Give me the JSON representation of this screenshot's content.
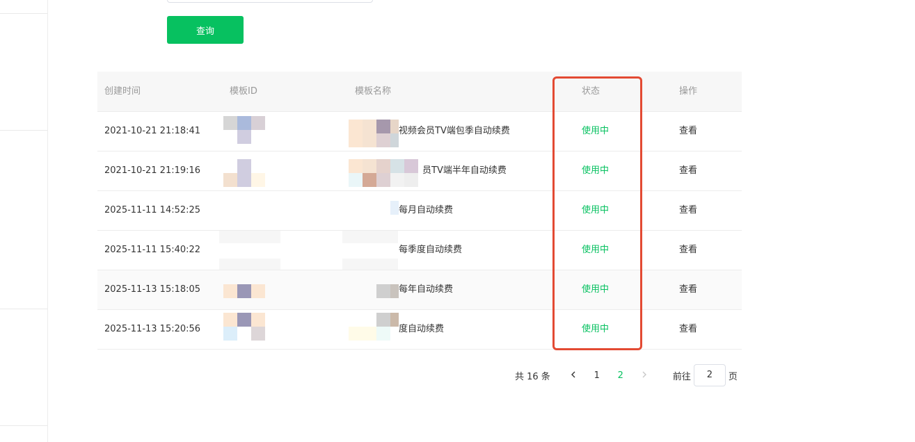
{
  "search": {
    "button_label": "查询"
  },
  "table": {
    "headers": [
      "创建时间",
      "模板ID",
      "模板名称",
      "状态",
      "操作"
    ],
    "rows": [
      {
        "time": "2021-10-21 21:18:41",
        "name": "视频会员TV端包季自动续费",
        "status": "使用中",
        "action": "查看"
      },
      {
        "time": "2021-10-21 21:19:16",
        "name": "员TV端半年自动续费",
        "status": "使用中",
        "action": "查看"
      },
      {
        "time": "2025-11-11 14:52:25",
        "name": "每月自动续费",
        "status": "使用中",
        "action": "查看"
      },
      {
        "time": "2025-11-11 15:40:22",
        "name": "每季度自动续费",
        "status": "使用中",
        "action": "查看"
      },
      {
        "time": "2025-11-13 15:18:05",
        "name": "每年自动续费",
        "status": "使用中",
        "action": "查看"
      },
      {
        "time": "2025-11-13 15:20:56",
        "name": "度自动续费",
        "status": "使用中",
        "action": "查看"
      }
    ]
  },
  "pagination": {
    "total_text": "共 16 条",
    "prev_icon": "chevron-left",
    "pages": [
      "1",
      "2"
    ],
    "current": "2",
    "next_icon": "chevron-right",
    "goto_label": "前往",
    "goto_value": "2",
    "page_suffix": "页"
  },
  "colors": {
    "accent": "#07c160",
    "highlight": "#e34a33"
  }
}
